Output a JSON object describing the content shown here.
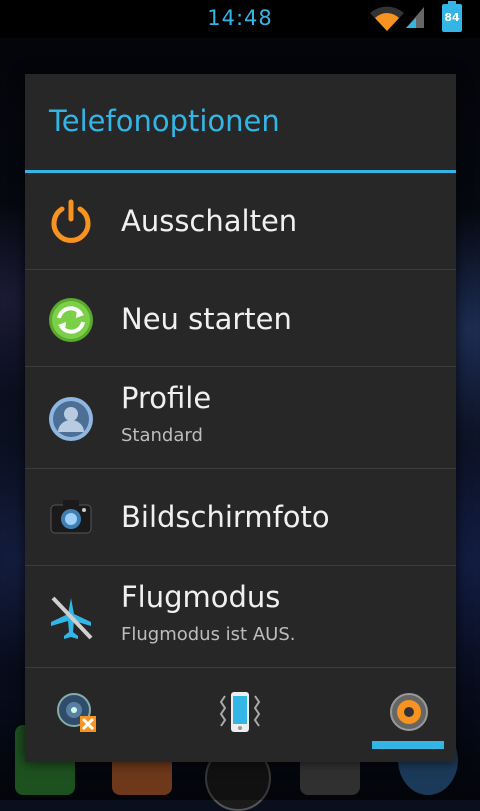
{
  "status_bar": {
    "time": "14:48",
    "battery_level": "84",
    "icons": [
      "wifi-icon",
      "signal-icon",
      "battery-icon"
    ]
  },
  "dialog": {
    "title": "Telefonoptionen",
    "items": [
      {
        "icon": "power-icon",
        "label": "Ausschalten",
        "subtitle": ""
      },
      {
        "icon": "restart-icon",
        "label": "Neu starten",
        "subtitle": ""
      },
      {
        "icon": "profile-icon",
        "label": "Profile",
        "subtitle": "Standard"
      },
      {
        "icon": "camera-icon",
        "label": "Bildschirmfoto",
        "subtitle": ""
      },
      {
        "icon": "airplane-icon",
        "label": "Flugmodus",
        "subtitle": "Flugmodus ist AUS."
      }
    ],
    "sound_modes": [
      {
        "icon": "sound-mute-icon",
        "selected": false
      },
      {
        "icon": "vibrate-icon",
        "selected": false
      },
      {
        "icon": "sound-on-icon",
        "selected": true
      }
    ]
  },
  "colors": {
    "accent": "#33b5e5",
    "dialog_bg": "#272727",
    "power_orange": "#f7931e",
    "restart_green": "#6cbf3b"
  }
}
